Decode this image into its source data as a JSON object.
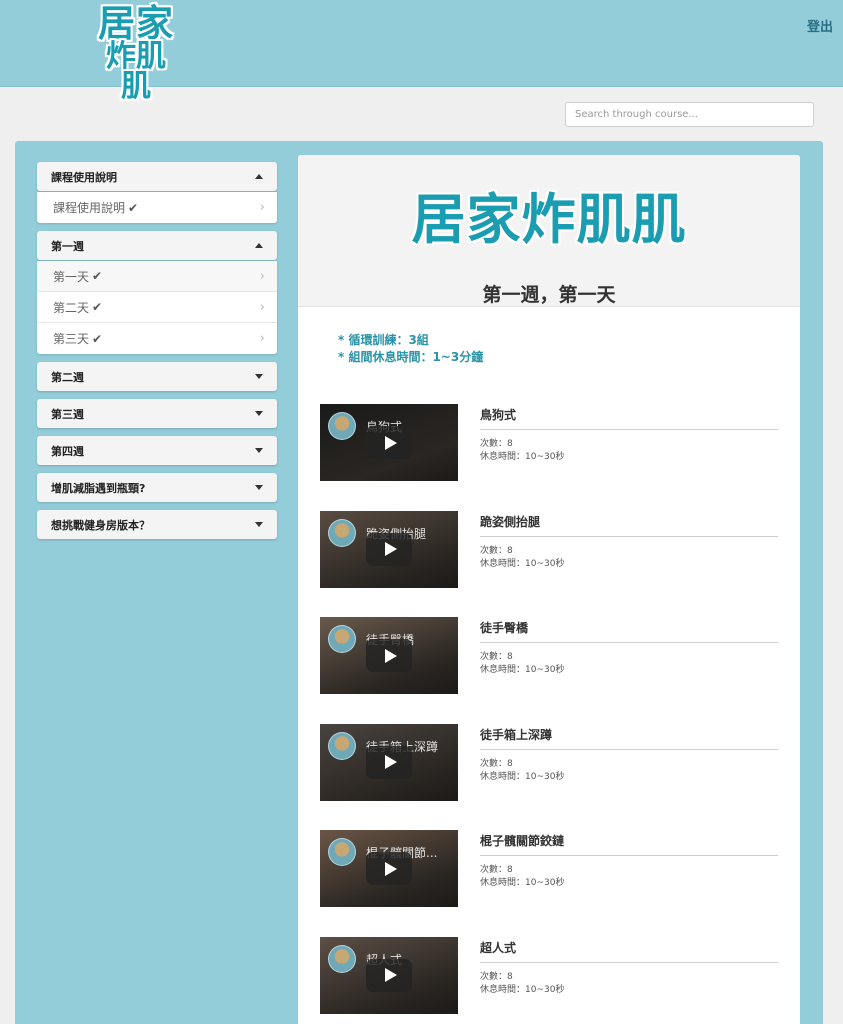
{
  "header": {
    "logo_line1": "居家",
    "logo_line2": "炸肌肌",
    "logout_label": "登出"
  },
  "search": {
    "placeholder": "Search through course..."
  },
  "sidebar": {
    "sections": [
      {
        "title": "課程使用說明",
        "expanded": true,
        "items": [
          {
            "label": "課程使用說明",
            "done": true
          }
        ]
      },
      {
        "title": "第一週",
        "expanded": true,
        "items": [
          {
            "label": "第一天",
            "done": true,
            "active": true
          },
          {
            "label": "第二天",
            "done": true
          },
          {
            "label": "第三天",
            "done": true
          }
        ]
      },
      {
        "title": "第二週",
        "expanded": false
      },
      {
        "title": "第三週",
        "expanded": false
      },
      {
        "title": "第四週",
        "expanded": false
      },
      {
        "title": "增肌減脂遇到瓶頸?",
        "expanded": false
      },
      {
        "title": "想挑戰健身房版本？",
        "expanded": false
      }
    ]
  },
  "main": {
    "hero_title": "居家炸肌肌",
    "hero_subtitle": "第一週，第一天",
    "notes": [
      "* 循環訓練：3組",
      "* 組間休息時間：1~3分鐘"
    ],
    "exercises": [
      {
        "name": "鳥狗式",
        "video_title": "鳥狗式",
        "reps": "次數：8",
        "rest": "休息時間：10~30秒",
        "tone": "#1a1a1a"
      },
      {
        "name": "跪姿側抬腿",
        "video_title": "跪姿側抬腿",
        "reps": "次數：8",
        "rest": "休息時間：10~30秒",
        "tone": "#5a4d42"
      },
      {
        "name": "徒手臀橋",
        "video_title": "徒手臀橋",
        "reps": "次數：8",
        "rest": "休息時間：10~30秒",
        "tone": "#6a5a4d"
      },
      {
        "name": "徒手箱上深蹲",
        "video_title": "徒手箱上深蹲",
        "reps": "次數：8",
        "rest": "休息時間：10~30秒",
        "tone": "#4a4440"
      },
      {
        "name": "棍子髖關節鉸鏈",
        "video_title": "棍子髖關節...",
        "reps": "次數：8",
        "rest": "休息時間：10~30秒",
        "tone": "#6b5646"
      },
      {
        "name": "超人式",
        "video_title": "超人式",
        "reps": "次數：8",
        "rest": "休息時間：10~30秒",
        "tone": "#5c4f46"
      }
    ]
  },
  "colors": {
    "accent": "#1a9db1",
    "topbar": "#92cdd9",
    "panel": "#92cdd9"
  }
}
